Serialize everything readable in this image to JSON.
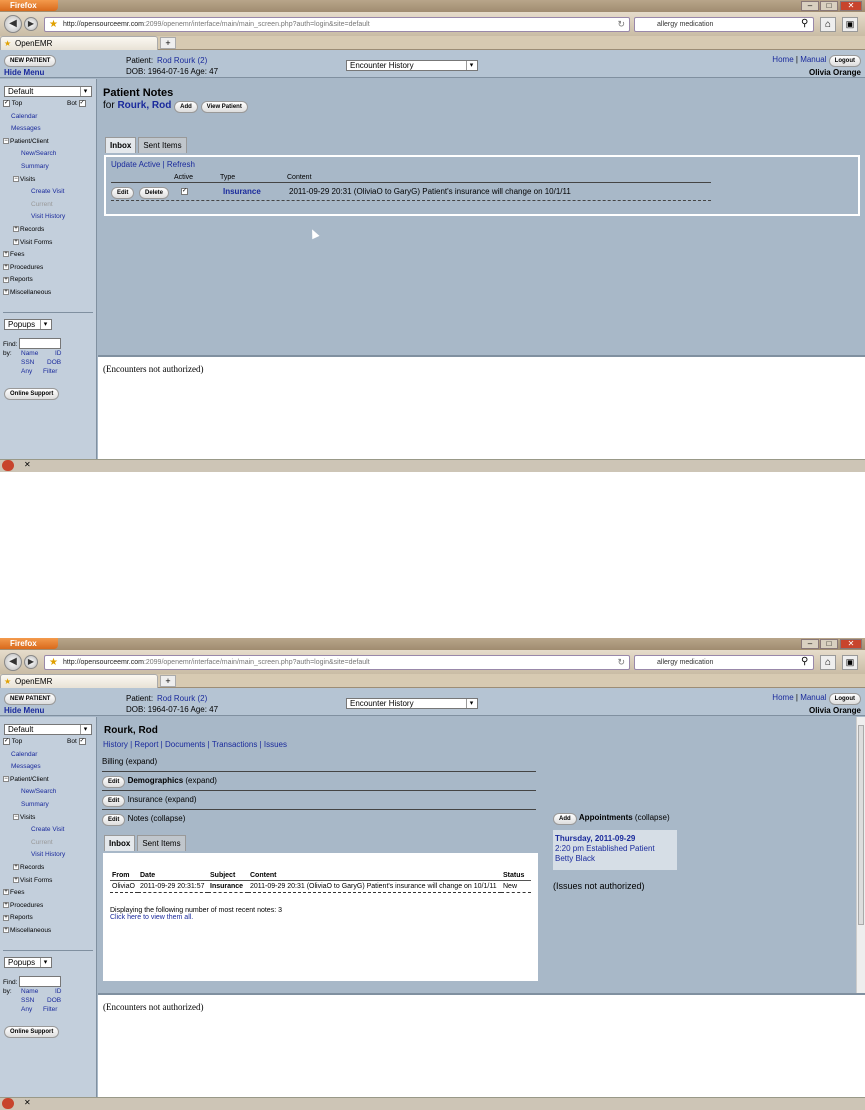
{
  "browser": {
    "app_button": "Firefox",
    "url_host": "http://opensourceemr.com",
    "url_rest": ":2099/openemr/interface/main/main_screen.php?auth=login&site=default",
    "search_text": "allergy medication",
    "tab_title": "OpenEMR",
    "tab_new": "+"
  },
  "header": {
    "new_patient": "NEW PATIENT",
    "hide_menu": "Hide Menu",
    "patient_label": "Patient:",
    "patient_name": "Rod Rourk (2)",
    "dob_line": "DOB: 1964-07-16 Age: 47",
    "encounter_select": "Encounter History",
    "home": "Home",
    "sep": "|",
    "manual": "Manual",
    "logout": "Logout",
    "user": "Olivia Orange"
  },
  "sidebar": {
    "mode": "Default",
    "top": "Top",
    "bot": "Bot",
    "items": [
      "Calendar",
      "Messages",
      "Patient/Client",
      "New/Search",
      "Summary",
      "Visits",
      "Create Visit",
      "Current",
      "Visit History",
      "Records",
      "Visit Forms",
      "Fees",
      "Procedures",
      "Reports",
      "Miscellaneous"
    ],
    "popups": "Popups",
    "find": "Find:",
    "by": "by:",
    "find_links": [
      "Name",
      "ID",
      "SSN",
      "DOB",
      "Any",
      "Filter"
    ],
    "online_support": "Online Support"
  },
  "notes_screen": {
    "title": "Patient Notes",
    "for": "for",
    "patient": "Rourk, Rod",
    "add": "Add",
    "view_patient": "View Patient",
    "tab_inbox": "Inbox",
    "tab_sent": "Sent Items",
    "update_active": "Update Active",
    "refresh": "Refresh",
    "cols": [
      "Active",
      "Type",
      "Content"
    ],
    "row": {
      "edit": "Edit",
      "delete": "Delete",
      "type": "Insurance",
      "content": "2011-09-29 20:31 (OliviaO to GaryG) Patient's insurance will change on 10/1/11"
    }
  },
  "summary_screen": {
    "patient": "Rourk, Rod",
    "links": [
      "History",
      "Report",
      "Documents",
      "Transactions",
      "Issues"
    ],
    "billing": "Billing",
    "expand": "(expand)",
    "collapse": "(collapse)",
    "sections": [
      "Demographics",
      "Insurance",
      "Notes"
    ],
    "edit": "Edit",
    "tab_inbox": "Inbox",
    "tab_sent": "Sent Items",
    "cols": [
      "From",
      "Date",
      "Subject",
      "Content",
      "Status"
    ],
    "row": {
      "from": "OliviaO",
      "date": "2011-09-29 20:31:57",
      "subject": "Insurance",
      "content": "2011-09-29 20:31 (OliviaO to GaryG) Patient's insurance will change on 10/1/11",
      "status": "New"
    },
    "displaying": "Displaying the following number of most recent notes: 3",
    "click_all": "Click here to view them all.",
    "appointments": "Appointments",
    "appt_add": "Add",
    "appt_date": "Thursday, 2011-09-29",
    "appt_time": "2:20 pm Established Patient",
    "appt_provider": "Betty Black",
    "issues_na": "(Issues not authorized)"
  },
  "encounters_na": "(Encounters not authorized)",
  "colors": {
    "accent_link": "#1a2a9c",
    "frame_bg": "#a8b8c8",
    "sidebar_bg": "#c3cfdc"
  }
}
